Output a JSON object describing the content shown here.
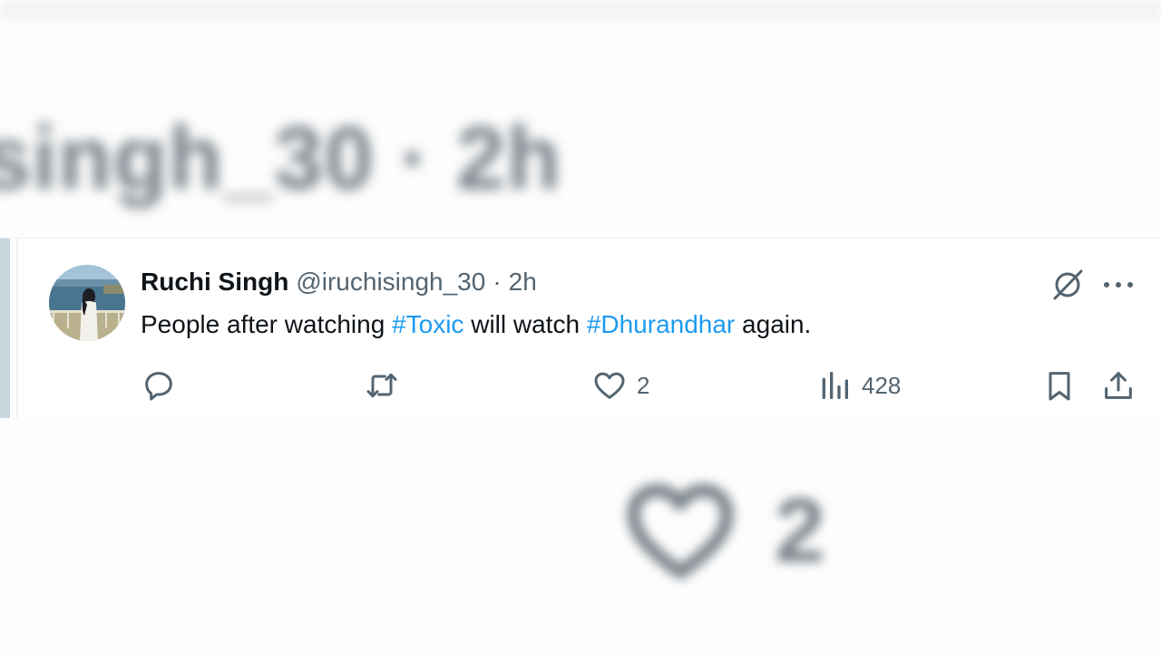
{
  "background": {
    "handle_time": "singh_30 · 2h",
    "like_count": "2"
  },
  "tweet": {
    "author_name": "Ruchi Singh",
    "author_handle": "@iruchisingh_30",
    "separator": "·",
    "time": "2h",
    "text_parts": [
      "People after watching ",
      " will watch ",
      " again."
    ],
    "hashtags": [
      "#Toxic",
      "#Dhurandhar"
    ],
    "actions": {
      "replies": "",
      "reposts": "",
      "likes": "2",
      "views": "428"
    }
  },
  "icons": {
    "reply": "reply-icon",
    "repost": "repost-icon",
    "like": "heart-icon",
    "views": "analytics-icon",
    "bookmark": "bookmark-icon",
    "share": "share-icon",
    "grok": "grok-icon",
    "more": "more-icon"
  },
  "colors": {
    "accent": "#1d9bf0",
    "text": "#0f1419",
    "muted": "#536471",
    "left_bar": "#c9d6de"
  }
}
